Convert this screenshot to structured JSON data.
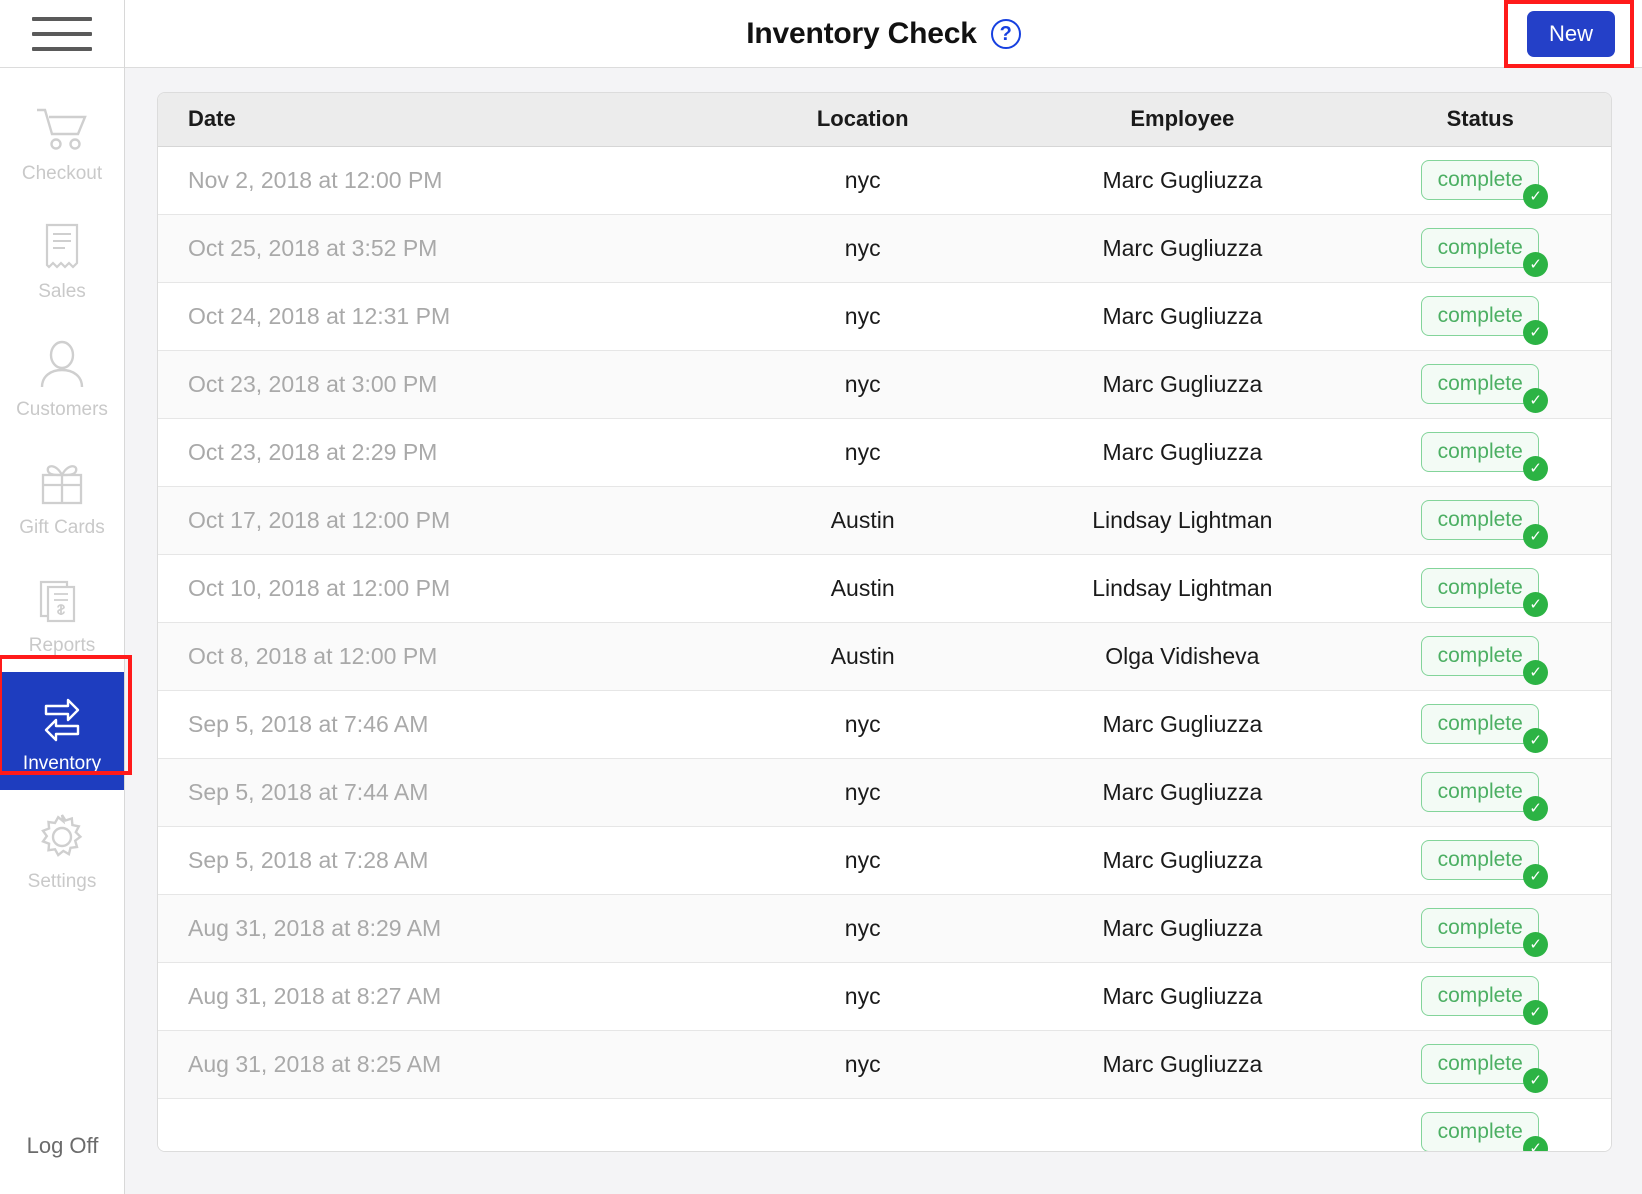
{
  "sidebar": {
    "menu_icon": "hamburger-icon",
    "items": [
      {
        "label": "Checkout",
        "icon": "shopping-cart-icon",
        "active": false
      },
      {
        "label": "Sales",
        "icon": "receipt-icon",
        "active": false
      },
      {
        "label": "Customers",
        "icon": "person-icon",
        "active": false
      },
      {
        "label": "Gift Cards",
        "icon": "gift-box-icon",
        "active": false
      },
      {
        "label": "Reports",
        "icon": "report-dollar-icon",
        "active": false
      },
      {
        "label": "Inventory",
        "icon": "transfer-arrows-icon",
        "active": true
      },
      {
        "label": "Settings",
        "icon": "gear-icon",
        "active": false
      }
    ],
    "log_off": "Log Off",
    "active_color": "#1E3DBF",
    "inactive_text_color": "#c9c9c9"
  },
  "header": {
    "title": "Inventory Check",
    "help_icon": "question-mark-circle-icon",
    "new_label": "New",
    "new_color": "#2440C8",
    "annotation_color": "#FF1A1A"
  },
  "table": {
    "columns": [
      "Date",
      "Location",
      "Employee",
      "Status"
    ],
    "rows": [
      {
        "date": "Nov 2, 2018 at 12:00 PM",
        "location": "nyc",
        "employee": "Marc Gugliuzza",
        "status": "complete"
      },
      {
        "date": "Oct 25, 2018 at 3:52 PM",
        "location": "nyc",
        "employee": "Marc Gugliuzza",
        "status": "complete"
      },
      {
        "date": "Oct 24, 2018 at 12:31 PM",
        "location": "nyc",
        "employee": "Marc Gugliuzza",
        "status": "complete"
      },
      {
        "date": "Oct 23, 2018 at 3:00 PM",
        "location": "nyc",
        "employee": "Marc Gugliuzza",
        "status": "complete"
      },
      {
        "date": "Oct 23, 2018 at 2:29 PM",
        "location": "nyc",
        "employee": "Marc Gugliuzza",
        "status": "complete"
      },
      {
        "date": "Oct 17, 2018 at 12:00 PM",
        "location": "Austin",
        "employee": "Lindsay Lightman",
        "status": "complete"
      },
      {
        "date": "Oct 10, 2018 at 12:00 PM",
        "location": "Austin",
        "employee": "Lindsay Lightman",
        "status": "complete"
      },
      {
        "date": "Oct 8, 2018 at 12:00 PM",
        "location": "Austin",
        "employee": "Olga Vidisheva",
        "status": "complete"
      },
      {
        "date": "Sep 5, 2018 at 7:46 AM",
        "location": "nyc",
        "employee": "Marc Gugliuzza",
        "status": "complete"
      },
      {
        "date": "Sep 5, 2018 at 7:44 AM",
        "location": "nyc",
        "employee": "Marc Gugliuzza",
        "status": "complete"
      },
      {
        "date": "Sep 5, 2018 at 7:28 AM",
        "location": "nyc",
        "employee": "Marc Gugliuzza",
        "status": "complete"
      },
      {
        "date": "Aug 31, 2018 at 8:29 AM",
        "location": "nyc",
        "employee": "Marc Gugliuzza",
        "status": "complete"
      },
      {
        "date": "Aug 31, 2018 at 8:27 AM",
        "location": "nyc",
        "employee": "Marc Gugliuzza",
        "status": "complete"
      },
      {
        "date": "Aug 31, 2018 at 8:25 AM",
        "location": "nyc",
        "employee": "Marc Gugliuzza",
        "status": "complete"
      },
      {
        "date": "",
        "location": "",
        "employee": "",
        "status": "complete"
      }
    ],
    "status_color": "#4caf63",
    "status_check_icon": "check-circle-icon"
  }
}
